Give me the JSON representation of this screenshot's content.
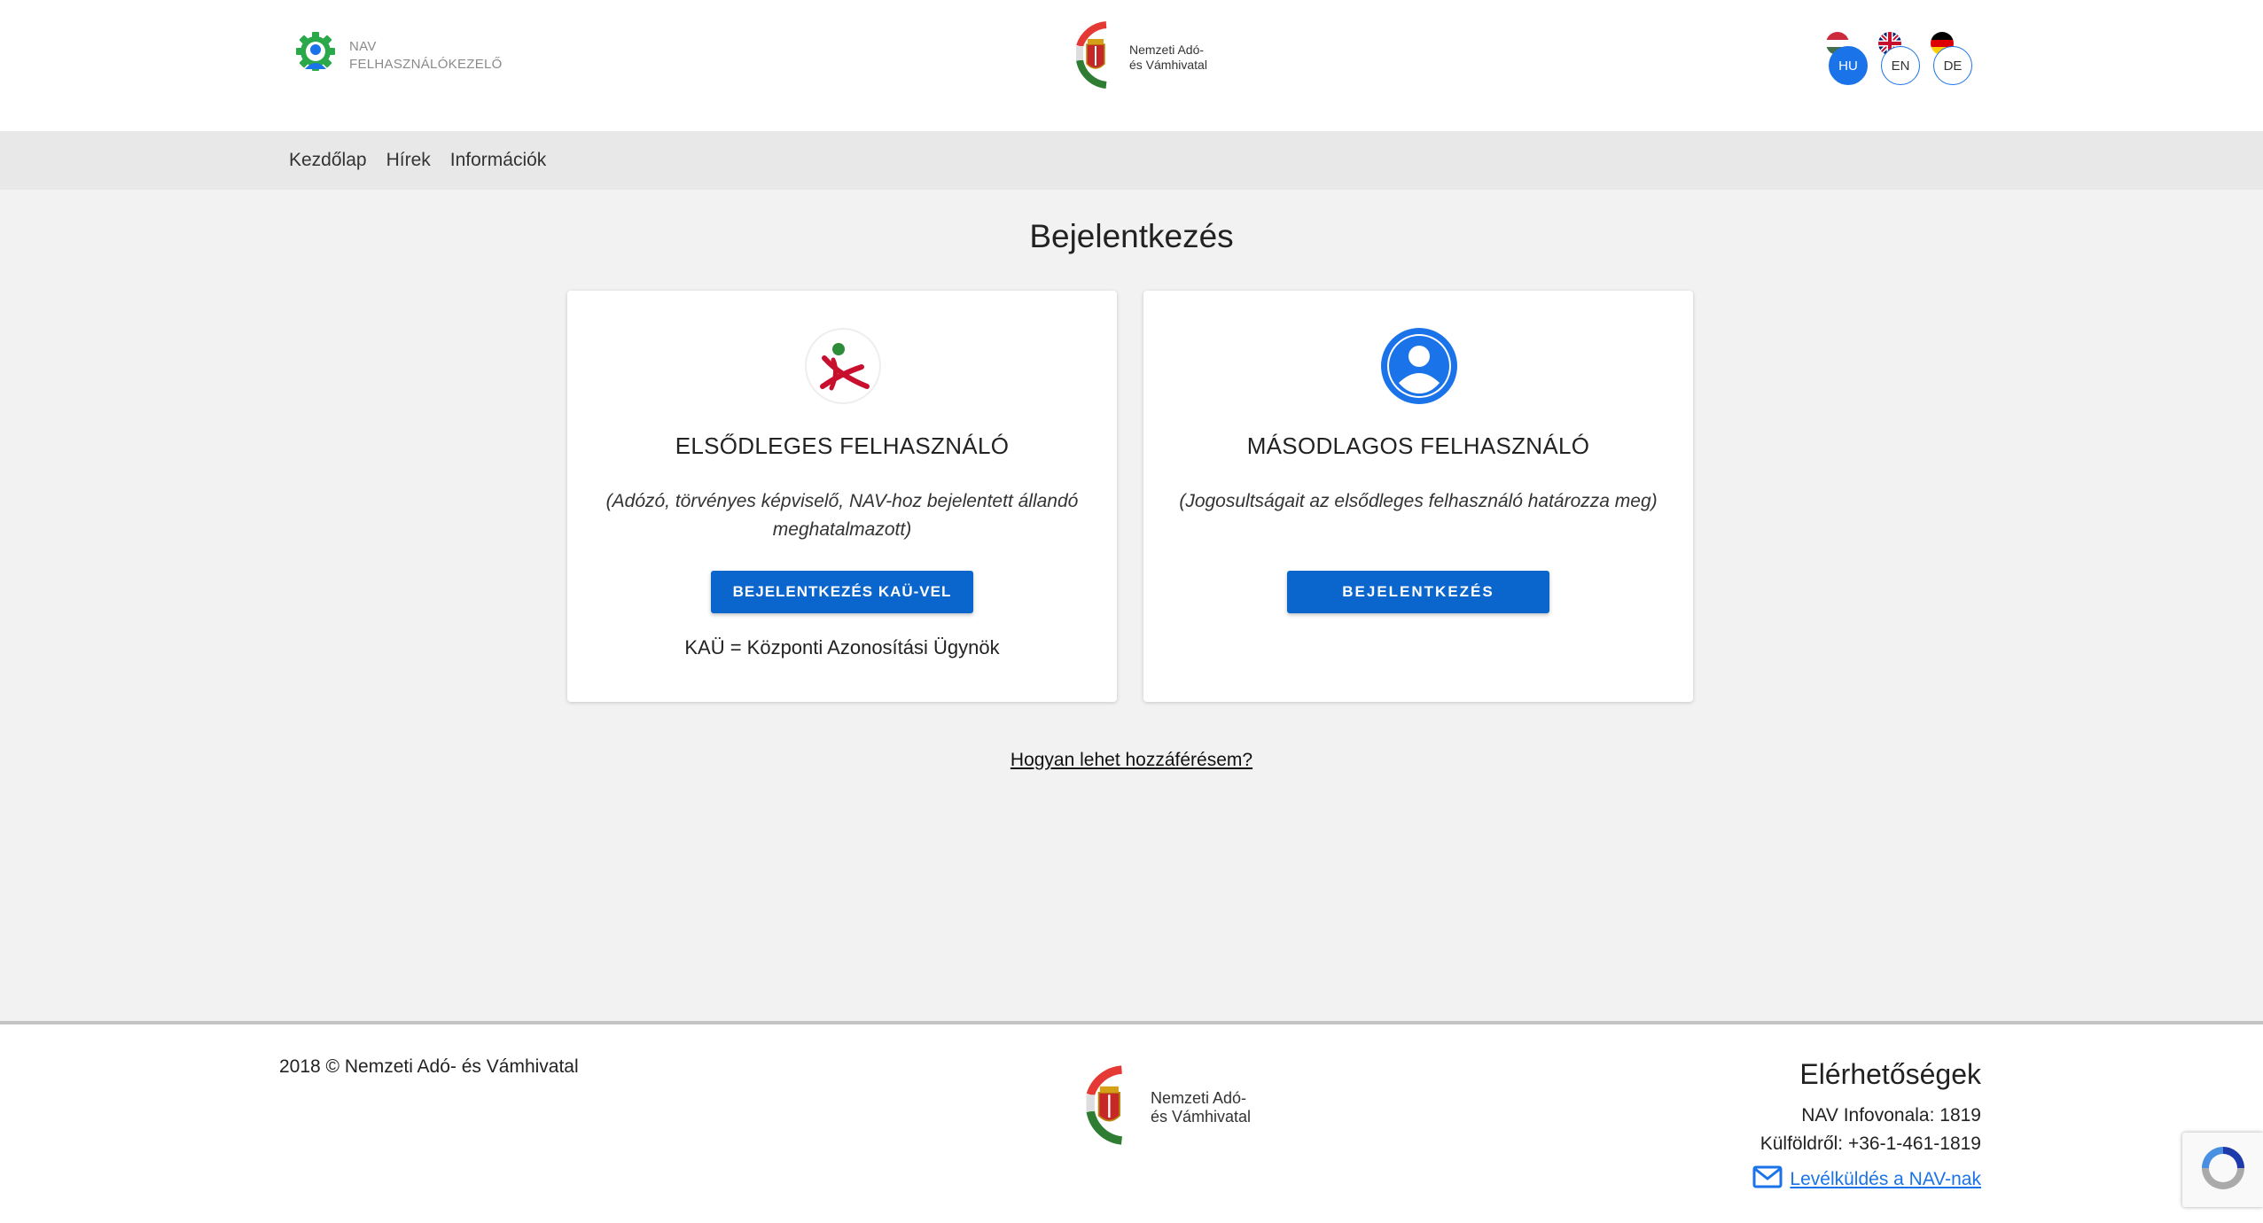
{
  "header": {
    "brand_line1": "NAV",
    "brand_line2": "FELHASZNÁLÓKEZELŐ",
    "nav_logo_line1": "Nemzeti Adó-",
    "nav_logo_line2": "és Vámhivatal",
    "languages": [
      {
        "code": "HU",
        "active": true
      },
      {
        "code": "EN",
        "active": false
      },
      {
        "code": "DE",
        "active": false
      }
    ]
  },
  "menu": {
    "items": [
      "Kezdőlap",
      "Hírek",
      "Információk"
    ]
  },
  "main": {
    "title": "Bejelentkezés",
    "cards": [
      {
        "title": "ELSŐDLEGES FELHASZNÁLÓ",
        "description": "(Adózó, törvényes képviselő, NAV-hoz bejelentett állandó meghatalmazott)",
        "button": "BEJELENTKEZÉS KAÜ-VEL",
        "note": "KAÜ = Központi Azonosítási Ügynök"
      },
      {
        "title": "MÁSODLAGOS FELHASZNÁLÓ",
        "description": "(Jogosultságait az elsődleges felhasználó határozza meg)",
        "button": "BEJELENTKEZÉS"
      }
    ],
    "access_link": "Hogyan lehet hozzáférésem?"
  },
  "footer": {
    "copyright": "2018 © Nemzeti Adó- és Vámhivatal",
    "logo_line1": "Nemzeti Adó-",
    "logo_line2": "és Vámhivatal",
    "contact_title": "Elérhetőségek",
    "infoline": "NAV Infovonala: 1819",
    "abroad": "Külföldről: +36-1-461-1819",
    "mail_link": "Levélküldés a NAV-nak"
  },
  "icons": {
    "brand": "gear-user-icon",
    "primary_user": "kau-logo-icon",
    "secondary_user": "account-circle-icon",
    "mail": "mail-icon",
    "recaptcha": "recaptcha-icon"
  },
  "colors": {
    "primary_button": "#0a66cc",
    "accent_blue": "#1a73e8",
    "brand_green": "#2aa84a"
  }
}
